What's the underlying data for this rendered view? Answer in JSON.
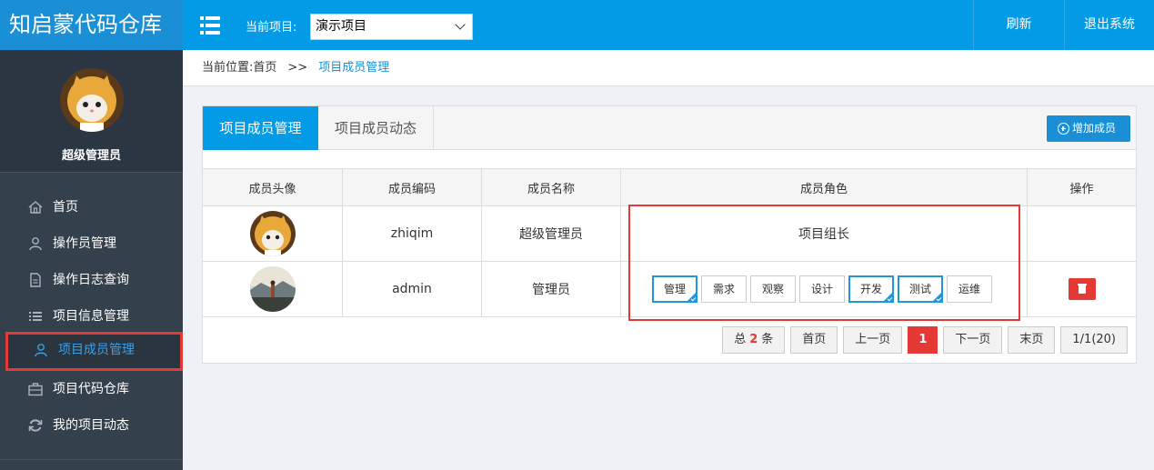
{
  "app": {
    "title": "知启蒙代码仓库"
  },
  "header": {
    "project_label": "当前项目:",
    "project_selected": "演示项目",
    "refresh_label": "刷新",
    "exit_label": "退出系统"
  },
  "user": {
    "name": "超级管理员"
  },
  "sidebar": {
    "items": [
      {
        "label": "首页",
        "icon": "home-icon"
      },
      {
        "label": "操作员管理",
        "icon": "user-icon"
      },
      {
        "label": "操作日志查询",
        "icon": "document-icon"
      },
      {
        "label": "项目信息管理",
        "icon": "list-icon"
      },
      {
        "label": "项目成员管理",
        "icon": "user-icon",
        "active": true
      },
      {
        "label": "项目代码仓库",
        "icon": "briefcase-icon"
      },
      {
        "label": "我的项目动态",
        "icon": "refresh-icon"
      }
    ]
  },
  "breadcrumb": {
    "prefix": "当前位置:",
    "home": "首页",
    "sep": ">>",
    "current": "项目成员管理"
  },
  "tabs": [
    {
      "label": "项目成员管理",
      "active": true
    },
    {
      "label": "项目成员动态",
      "active": false
    }
  ],
  "add_button": "增加成员",
  "table": {
    "columns": [
      "成员头像",
      "成员编码",
      "成员名称",
      "成员角色",
      "操作"
    ],
    "rows": [
      {
        "code": "zhiqim",
        "name": "超级管理员",
        "role_text": "项目组长"
      },
      {
        "code": "admin",
        "name": "管理员"
      }
    ],
    "roles": [
      {
        "label": "管理",
        "selected": true
      },
      {
        "label": "需求",
        "selected": false
      },
      {
        "label": "观察",
        "selected": false
      },
      {
        "label": "设计",
        "selected": false
      },
      {
        "label": "开发",
        "selected": true
      },
      {
        "label": "测试",
        "selected": true
      },
      {
        "label": "运维",
        "selected": false
      }
    ]
  },
  "pagination": {
    "total_prefix": "总",
    "total_count": "2",
    "total_suffix": "条",
    "first": "首页",
    "prev": "上一页",
    "current": "1",
    "next": "下一页",
    "last": "末页",
    "summary": "1/1(20)"
  },
  "colors": {
    "header": "#039be5",
    "sidebar": "#34404c",
    "accent": "#1a8fd6",
    "danger": "#e53935"
  }
}
